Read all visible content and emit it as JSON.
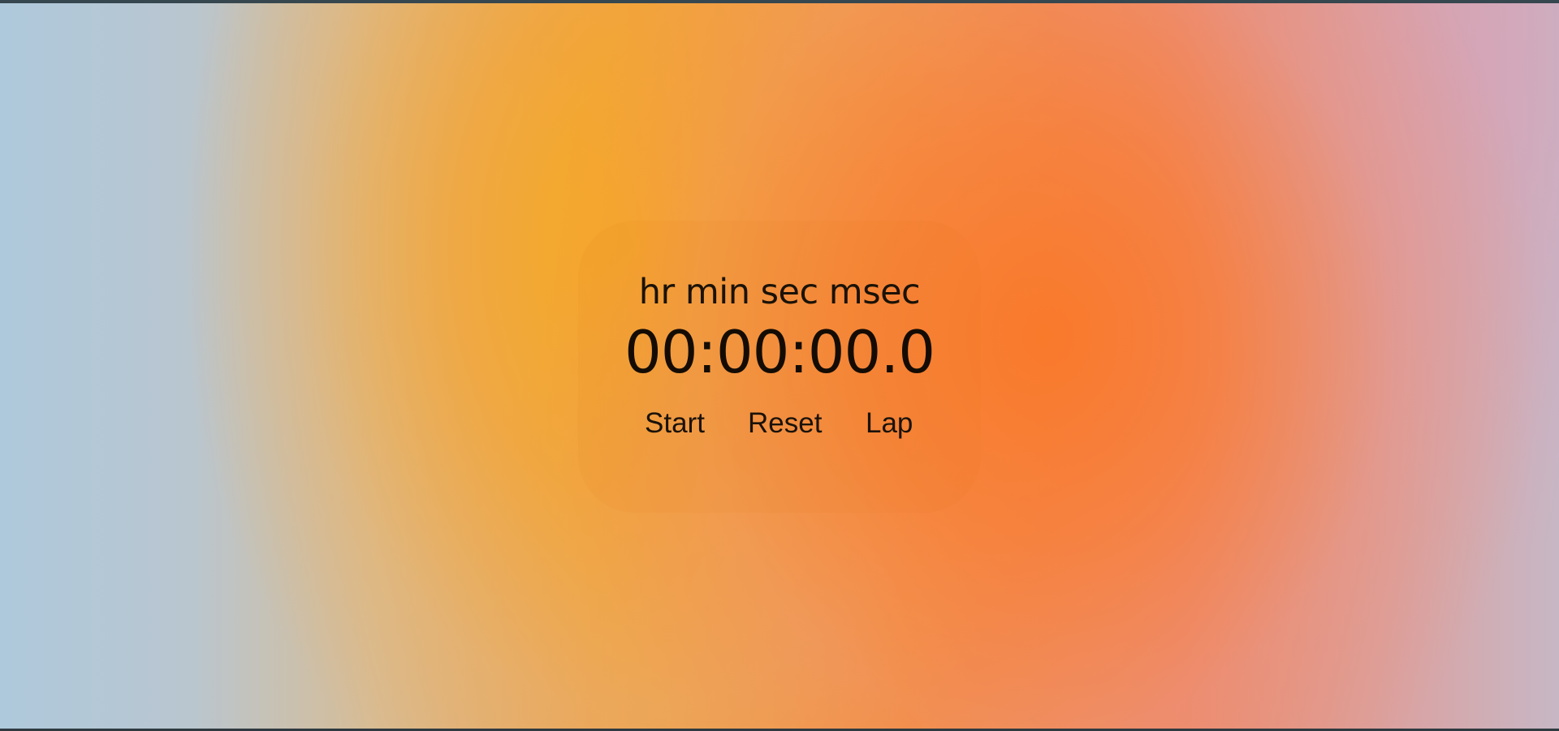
{
  "stopwatch": {
    "units_label": "hr min sec msec",
    "time": "00:00:00.0",
    "buttons": {
      "start": "Start",
      "reset": "Reset",
      "lap": "Lap"
    }
  },
  "colors": {
    "text": "#1a1208",
    "top_bar": "#37474f",
    "gradient_orange": "#f39040",
    "gradient_yellow": "#f6aa1e",
    "gradient_blue": "#aec9dc"
  }
}
